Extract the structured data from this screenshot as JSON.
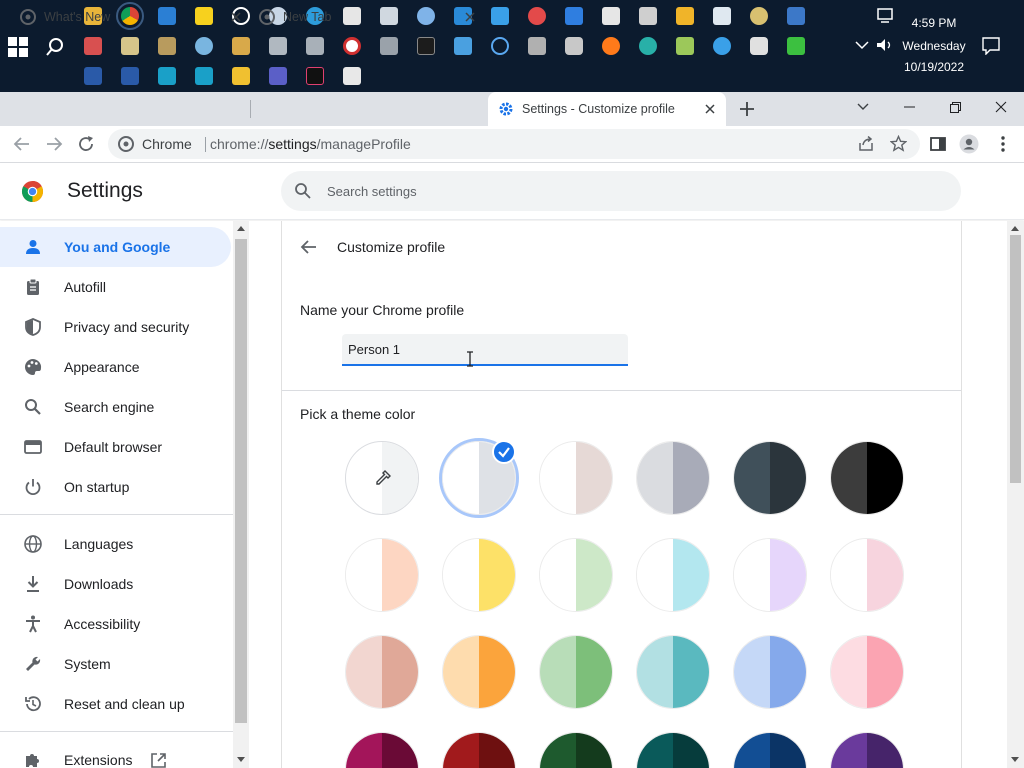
{
  "taskbar": {
    "time": "4:59 PM",
    "day": "Wednesday",
    "date": "10/19/2022"
  },
  "tabs": [
    {
      "title": "What's New",
      "favicon": "chrome-icon"
    },
    {
      "title": "New Tab",
      "favicon": "chrome-icon"
    },
    {
      "title": "Settings - Customize profile",
      "favicon": "gear-icon"
    }
  ],
  "toolbar": {
    "site_label": "Chrome",
    "url_scheme": "chrome://",
    "url_host": "settings",
    "url_path": "/manageProfile"
  },
  "header": {
    "title": "Settings",
    "search_placeholder": "Search settings"
  },
  "sidebar": {
    "items": [
      {
        "label": "You and Google",
        "icon": "person-icon"
      },
      {
        "label": "Autofill",
        "icon": "clipboard-icon"
      },
      {
        "label": "Privacy and security",
        "icon": "shield-icon"
      },
      {
        "label": "Appearance",
        "icon": "palette-icon"
      },
      {
        "label": "Search engine",
        "icon": "search-icon"
      },
      {
        "label": "Default browser",
        "icon": "browser-icon"
      },
      {
        "label": "On startup",
        "icon": "power-icon"
      },
      {
        "label": "Languages",
        "icon": "globe-icon"
      },
      {
        "label": "Downloads",
        "icon": "download-icon"
      },
      {
        "label": "Accessibility",
        "icon": "accessibility-icon"
      },
      {
        "label": "System",
        "icon": "wrench-icon"
      },
      {
        "label": "Reset and clean up",
        "icon": "history-icon"
      },
      {
        "label": "Extensions",
        "icon": "puzzle-icon"
      }
    ]
  },
  "profile": {
    "back_label": "Customize profile",
    "name_label": "Name your Chrome profile",
    "name_value": "Person 1",
    "theme_label": "Pick a theme color"
  },
  "colors": {
    "accent": "#1a73e8",
    "active_nav_bg": "#e8f0fe",
    "taskbar_bg": "#0c1b2e",
    "tabstrip_bg": "#dee1e6"
  },
  "themes": [
    [
      "#f1f3f4",
      "#f1f3f4"
    ],
    [
      "#ffffff",
      "#dee1e6"
    ],
    [
      "#ffffff",
      "#e6d9d6"
    ],
    [
      "#dadce0",
      "#a8abb8"
    ],
    [
      "#40505a",
      "#2b353c"
    ],
    [
      "#3c3c3c",
      "#000000"
    ],
    [
      "#ffffff",
      "#fdd6c2"
    ],
    [
      "#ffffff",
      "#fde168"
    ],
    [
      "#ffffff",
      "#cde8c8"
    ],
    [
      "#ffffff",
      "#b3e7ef"
    ],
    [
      "#ffffff",
      "#e6d6fb"
    ],
    [
      "#ffffff",
      "#f7d4de"
    ],
    [
      "#f2d6d0",
      "#e0a898"
    ],
    [
      "#fedcae",
      "#fba43c"
    ],
    [
      "#b8ddb8",
      "#7dbf7a"
    ],
    [
      "#b2e0e3",
      "#5ab9bf"
    ],
    [
      "#c5d8f7",
      "#85a9eb"
    ],
    [
      "#fddce2",
      "#fba4b2"
    ],
    [
      "#a3155a",
      "#6a0a36"
    ],
    [
      "#a11a1c",
      "#6e1010"
    ],
    [
      "#1e5a2e",
      "#143b1d"
    ],
    [
      "#0a5a5a",
      "#063c3c"
    ],
    [
      "#124e94",
      "#0b3466"
    ],
    [
      "#6a3a9c",
      "#46246a"
    ]
  ]
}
